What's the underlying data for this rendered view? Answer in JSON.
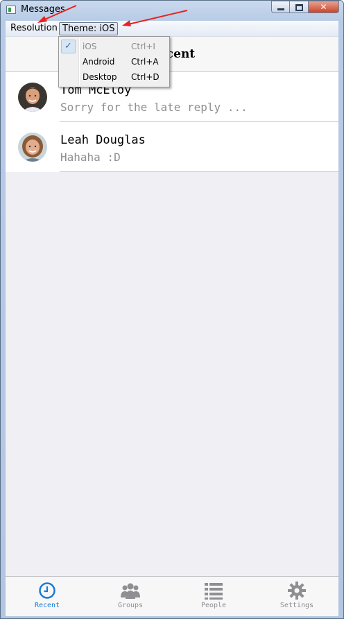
{
  "window": {
    "title": "Messages"
  },
  "menubar": {
    "resolution": "Resolution",
    "theme": "Theme: iOS"
  },
  "header": {
    "title": "Recent"
  },
  "conversations": [
    {
      "name": "Tom McEloy",
      "preview": "Sorry for the late reply ..."
    },
    {
      "name": "Leah Douglas",
      "preview": "Hahaha :D"
    }
  ],
  "theme_menu": {
    "items": [
      {
        "label": "iOS",
        "shortcut": "Ctrl+I",
        "checked": true,
        "enabled": false
      },
      {
        "label": "Android",
        "shortcut": "Ctrl+A",
        "checked": false,
        "enabled": true
      },
      {
        "label": "Desktop",
        "shortcut": "Ctrl+D",
        "checked": false,
        "enabled": true
      }
    ]
  },
  "tabs": [
    {
      "label": "Recent",
      "icon": "clock-icon",
      "active": true
    },
    {
      "label": "Groups",
      "icon": "group-icon",
      "active": false
    },
    {
      "label": "People",
      "icon": "list-icon",
      "active": false
    },
    {
      "label": "Settings",
      "icon": "gear-icon",
      "active": false
    }
  ],
  "colors": {
    "accent": "#1b7ad6",
    "inactive": "#8e8e93",
    "annotation": "#e8231f"
  }
}
